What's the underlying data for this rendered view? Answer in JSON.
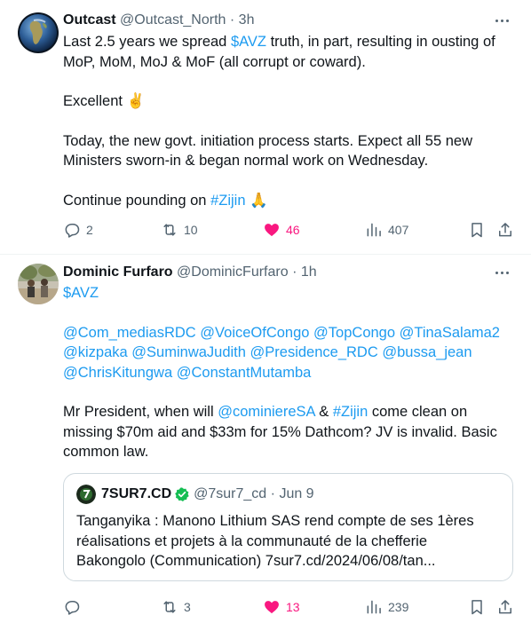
{
  "tweets": [
    {
      "name": "Outcast",
      "handle": "@Outcast_North",
      "time": "3h",
      "body": {
        "p1_a": "Last 2.5 years we spread ",
        "p1_cashtag": "$AVZ",
        "p1_b": " truth, in part, resulting in ousting of MoP, MoM, MoJ & MoF (all corrupt or coward).",
        "p2": "Excellent ✌️",
        "p3": "Today, the new govt. initiation process starts. Expect all 55 new Ministers sworn-in & began normal work on Wednesday.",
        "p4_a": "Continue pounding on ",
        "p4_hashtag": "#Zijin",
        "p4_b": " 🙏"
      },
      "stats": {
        "replies": "2",
        "reposts": "10",
        "likes": "46",
        "views": "407"
      }
    },
    {
      "name": "Dominic Furfaro",
      "handle": "@DominicFurfaro",
      "time": "1h",
      "body": {
        "cashtag": "$AVZ",
        "mentions": [
          "@Com_mediasRDC",
          "@VoiceOfCongo",
          "@TopCongo",
          "@TinaSalama2",
          "@kizpaka",
          "@SuminwaJudith",
          "@Presidence_RDC",
          "@bussa_jean",
          "@ChrisKitungwa",
          "@ConstantMutamba"
        ],
        "p3_a": "Mr President, when will ",
        "p3_mention": "@cominiereSA",
        "p3_b": " & ",
        "p3_hashtag": "#Zijin",
        "p3_c": " come clean on missing $70m aid and $33m for 15% Dathcom? JV is invalid. Basic common law."
      },
      "quote": {
        "name": "7SUR7.CD",
        "handle": "@7sur7_cd",
        "time": "Jun 9",
        "text": "Tanganyika : Manono Lithium SAS rend compte de ses 1ères réalisations et projets à la communauté de la chefferie Bakongolo (Communication) 7sur7.cd/2024/06/08/tan..."
      },
      "stats": {
        "replies": "",
        "reposts": "3",
        "likes": "13",
        "views": "239"
      }
    }
  ],
  "colors": {
    "accent": "#1d9bf0",
    "like": "#f91880",
    "muted": "#536471",
    "text": "#0f1419",
    "verified": "#15be53"
  },
  "icons": [
    "reply-icon",
    "repost-icon",
    "like-icon",
    "views-icon",
    "bookmark-icon",
    "share-icon",
    "more-icon",
    "verified-icon"
  ]
}
